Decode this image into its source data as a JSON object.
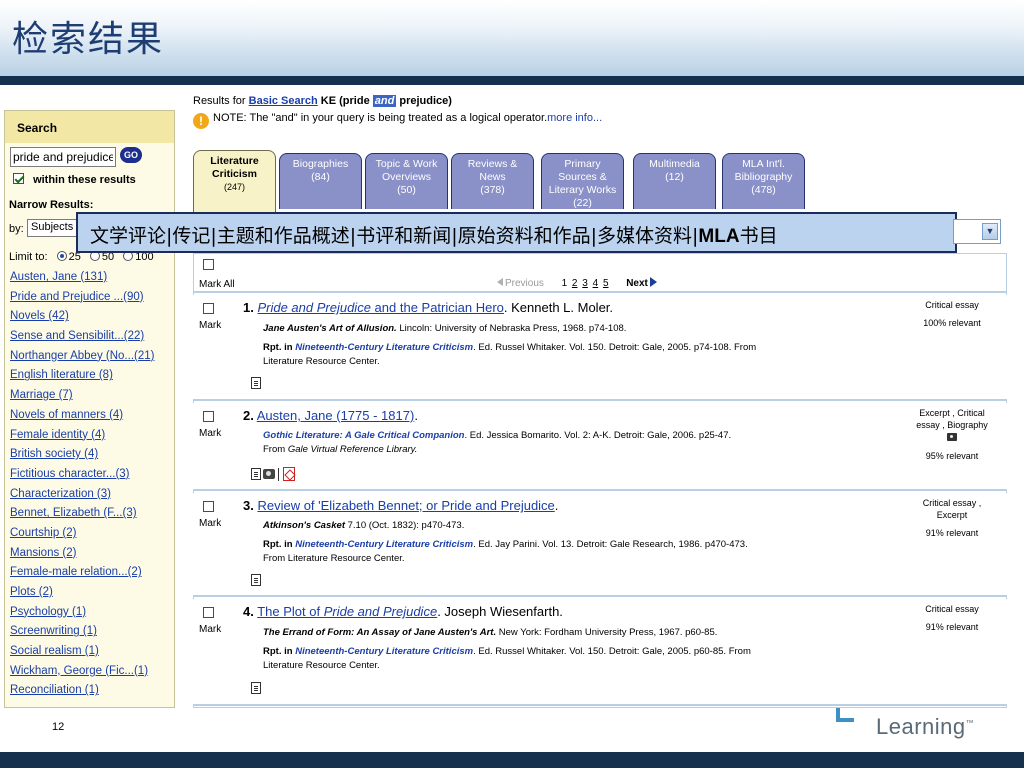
{
  "slide": {
    "title": "检索结果",
    "page_number": "12",
    "logo_text": "Learning",
    "logo_tm": "™"
  },
  "sidebar": {
    "search_header": "Search",
    "search_value": "pride and prejudice",
    "go_label": "GO",
    "within_label": "within these results",
    "narrow_header": "Narrow Results:",
    "by_label": "by:",
    "by_value": "Subjects",
    "limit_label": "Limit to:",
    "limit_options": [
      "25",
      "50",
      "100"
    ],
    "subjects": [
      "Austen, Jane (131)",
      "Pride and Prejudice ...(90)",
      "Novels (42)",
      "Sense and Sensibilit...(22)",
      "Northanger Abbey (No...(21)",
      "English literature (8)",
      "Marriage (7)",
      "Novels of manners (4)",
      "Female identity (4)",
      "British society (4)",
      "Fictitious character...(3)",
      "Characterization (3)",
      "Bennet, Elizabeth (F...(3)",
      "Courtship (2)",
      "Mansions (2)",
      "Female-male relation...(2)",
      "Plots (2)",
      "Psychology (1)",
      "Screenwriting (1)",
      "Social realism (1)",
      "Wickham, George (Fic...(1)",
      "Reconciliation (1)"
    ]
  },
  "header": {
    "results_for": "Results for ",
    "basic_search": "Basic Search",
    "ke_label": " KE (pride ",
    "and_op": "and",
    "ke_end": " prejudice)",
    "note_text": "NOTE: The \"and\" in your query is being treated as a logical operator.",
    "more_info": "more info..."
  },
  "tabs": [
    {
      "label1": "Literature",
      "label2": "Criticism",
      "label3": "",
      "count": "(247)"
    },
    {
      "label1": "Biographies",
      "label2": "",
      "label3": "",
      "count": "(84)"
    },
    {
      "label1": "Topic & Work",
      "label2": "Overviews",
      "label3": "",
      "count": "(50)"
    },
    {
      "label1": "Reviews &",
      "label2": "News",
      "label3": "",
      "count": "(378)"
    },
    {
      "label1": "Primary",
      "label2": "Sources &",
      "label3": "Literary Works",
      "count": "(22)"
    },
    {
      "label1": "Multimedia",
      "label2": "",
      "label3": "",
      "count": "(12)"
    },
    {
      "label1": "MLA Int'l.",
      "label2": "Bibliography",
      "label3": "",
      "count": "(478)"
    }
  ],
  "banner": {
    "text": "文学评论|传记|主题和作品概述|书评和新闻|原始资料和作品|多媒体资料|",
    "bold": "MLA",
    "tail": "书目"
  },
  "toolbar": {
    "mark_all": "Mark All",
    "previous": "Previous",
    "pages": [
      "1",
      "2",
      "3",
      "4",
      "5"
    ],
    "next": "Next"
  },
  "results": [
    {
      "num": "1.",
      "title_a": "Pride and Prejudice",
      "title_b": " and the Patrician Hero",
      "author": ". Kenneth L. Moler.",
      "line1_bi": "Jane Austen's Art of Allusion.",
      "line1_rest": " Lincoln: University of Nebraska Press, 1968. p74-108.",
      "line2_b": "Rpt. in ",
      "line2_blue": "Nineteenth-Century Literature Criticism",
      "line2_rest": ". Ed. Russel Whitaker. Vol. 150.  Detroit: Gale, 2005. p74-108. From",
      "line3_it": "Literature Resource Center.",
      "type": "Critical essay",
      "relevance": "100% relevant",
      "mark": "Mark"
    },
    {
      "num": "2.",
      "title_a": "",
      "title_b": "Austen, Jane (1775 - 1817)",
      "author": ".",
      "line1_bi": "Gothic Literature: A Gale Critical Companion",
      "line1_rest": ". Ed. Jessica Bomarito. Vol. 2: A-K.  Detroit: Gale, 2006. p25-47.",
      "line2_b": "",
      "line2_blue": "",
      "line2_rest": "From ",
      "line3_it": "Gale Virtual Reference Library.",
      "type": "Excerpt , Critical essay , Biography",
      "relevance": "95% relevant",
      "mark": "Mark"
    },
    {
      "num": "3.",
      "title_a": "",
      "title_b": "Review of 'Elizabeth Bennet; or Pride and Prejudice",
      "author": ".",
      "line1_bi": "Atkinson's Casket",
      "line1_rest": " 7.10 (Oct. 1832): p470-473.",
      "line2_b": "Rpt. in ",
      "line2_blue": "Nineteenth-Century Literature Criticism",
      "line2_rest": ". Ed. Jay Parini. Vol. 13.  Detroit: Gale Research, 1986. p470-473.",
      "line3_it": "From Literature Resource Center.",
      "type": "Critical essay , Excerpt",
      "relevance": "91% relevant",
      "mark": "Mark"
    },
    {
      "num": "4.",
      "title_a": "The Plot of ",
      "title_b": "Pride and Prejudice",
      "author": ". Joseph Wiesenfarth.",
      "line1_bi": "The Errand of Form: An Assay of Jane Austen's Art.",
      "line1_rest": " New York: Fordham University Press, 1967. p60-85.",
      "line2_b": "Rpt. in ",
      "line2_blue": "Nineteenth-Century Literature Criticism",
      "line2_rest": ". Ed. Russel Whitaker. Vol. 150.  Detroit: Gale, 2005. p60-85. From",
      "line3_it": "Literature Resource Center.",
      "type": "Critical essay",
      "relevance": "91% relevant",
      "mark": "Mark"
    }
  ]
}
